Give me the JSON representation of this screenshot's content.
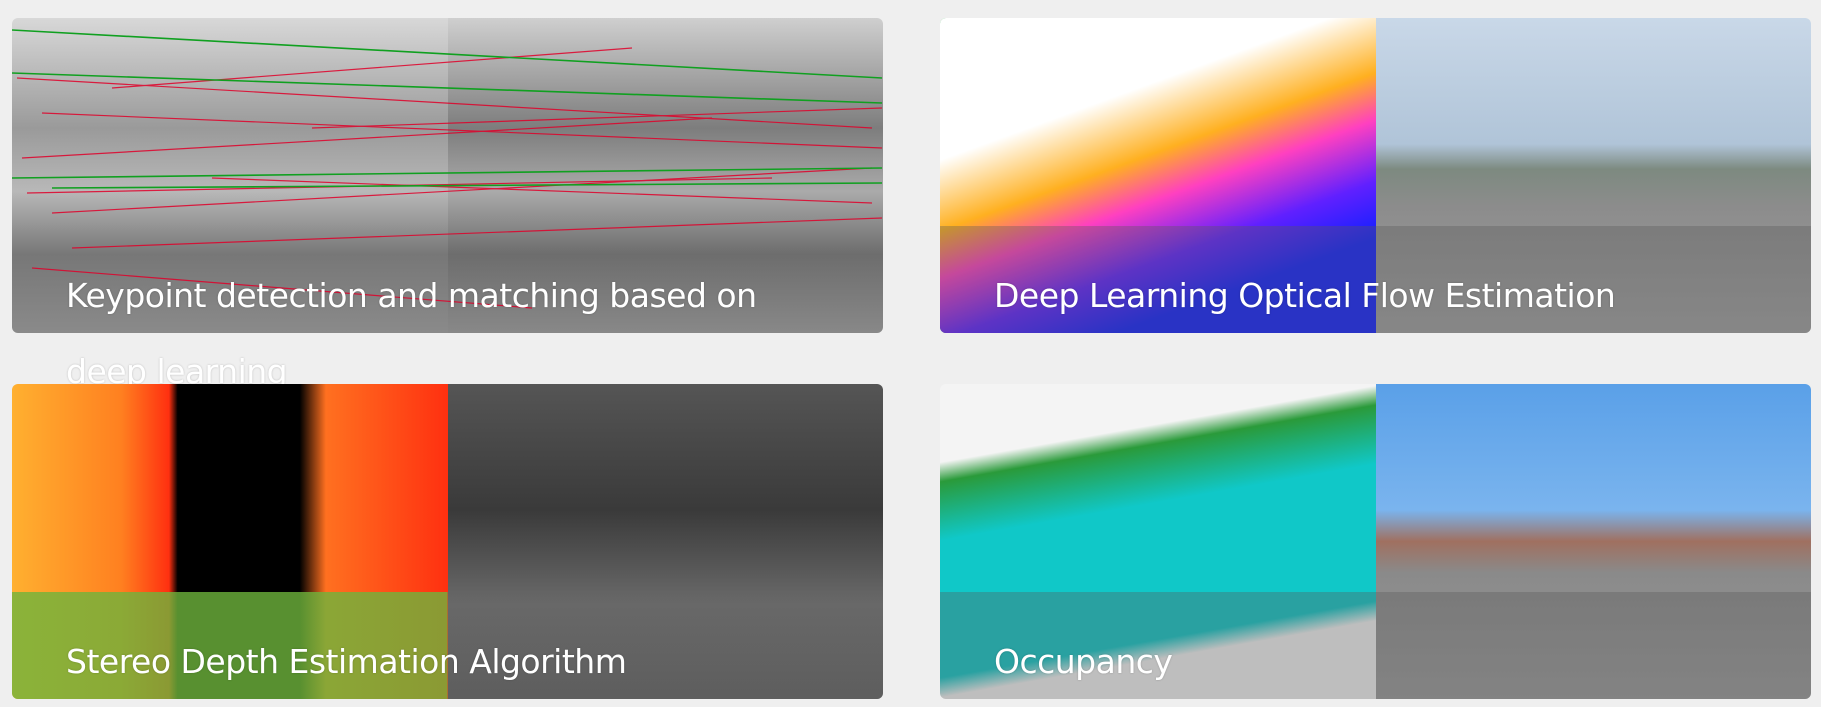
{
  "cards": [
    {
      "title": "Keypoint detection and matching based on deep learning"
    },
    {
      "title": "Deep Learning Optical Flow Estimation"
    },
    {
      "title": "Stereo Depth Estimation Algorithm"
    },
    {
      "title": "Occupancy"
    }
  ]
}
